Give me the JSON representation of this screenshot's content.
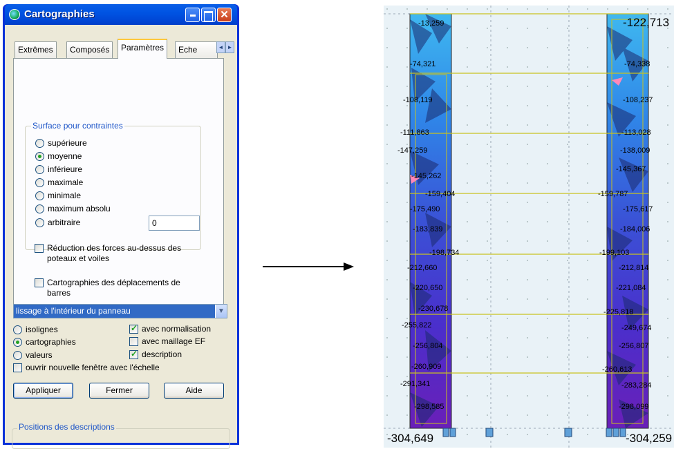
{
  "window": {
    "title": "Cartographies",
    "tabs": [
      "Extrêmes",
      "Composés",
      "Paramètres",
      "Eche"
    ],
    "tab_scroll": [
      "◄",
      "►"
    ],
    "group_title": "Surface pour contraintes",
    "surface_options": [
      "supérieure",
      "moyenne",
      "inférieure",
      "maximale",
      "minimale",
      "maximum absolu",
      "arbitraire"
    ],
    "selected_surface": "moyenne",
    "arbitrary_value": "0",
    "checkbox_reduction": "Réduction des forces au-dessus des poteaux et voiles",
    "checkbox_displacement": "Cartographies des déplacements de barres",
    "smoothing_select": "lissage à l'intérieur du panneau",
    "display_modes": [
      "isolignes",
      "cartographies",
      "valeurs"
    ],
    "selected_mode": "cartographies",
    "opt_normalisation": "avec normalisation",
    "opt_maillage": "avec maillage EF",
    "opt_description": "description",
    "opt_new_window": "ouvrir nouvelle fenêtre avec l'échelle",
    "btn_apply": "Appliquer",
    "btn_close": "Fermer",
    "btn_help": "Aide",
    "positions_group": "Positions des descriptions"
  },
  "colors": {
    "titlebar": "#0054e3",
    "window_bg": "#ece9d8",
    "selection": "#316ac5",
    "radio_dot": "#21a121"
  },
  "map": {
    "left_wall_labels": [
      "-13,259",
      "-74,321",
      "-108,119",
      "-111,863",
      "-147,259",
      "-145,262",
      "-159,404",
      "-175,490",
      "-183,839",
      "-198,734",
      "-212,660",
      "-220,650",
      "-230,678",
      "-255,822",
      "-256,804",
      "-260,909",
      "-291,341",
      "-298,585",
      "-304,649"
    ],
    "right_wall_labels": [
      "-122,713",
      "-74,338",
      "-108,237",
      "-113,028",
      "-138,009",
      "-145,367",
      "-159,787",
      "-175,617",
      "-184,006",
      "-199,103",
      "-212,814",
      "-221,084",
      "-225,818",
      "-249,674",
      "-256,807",
      "-260,613",
      "-283,284",
      "-298,099",
      "-304,259"
    ]
  }
}
